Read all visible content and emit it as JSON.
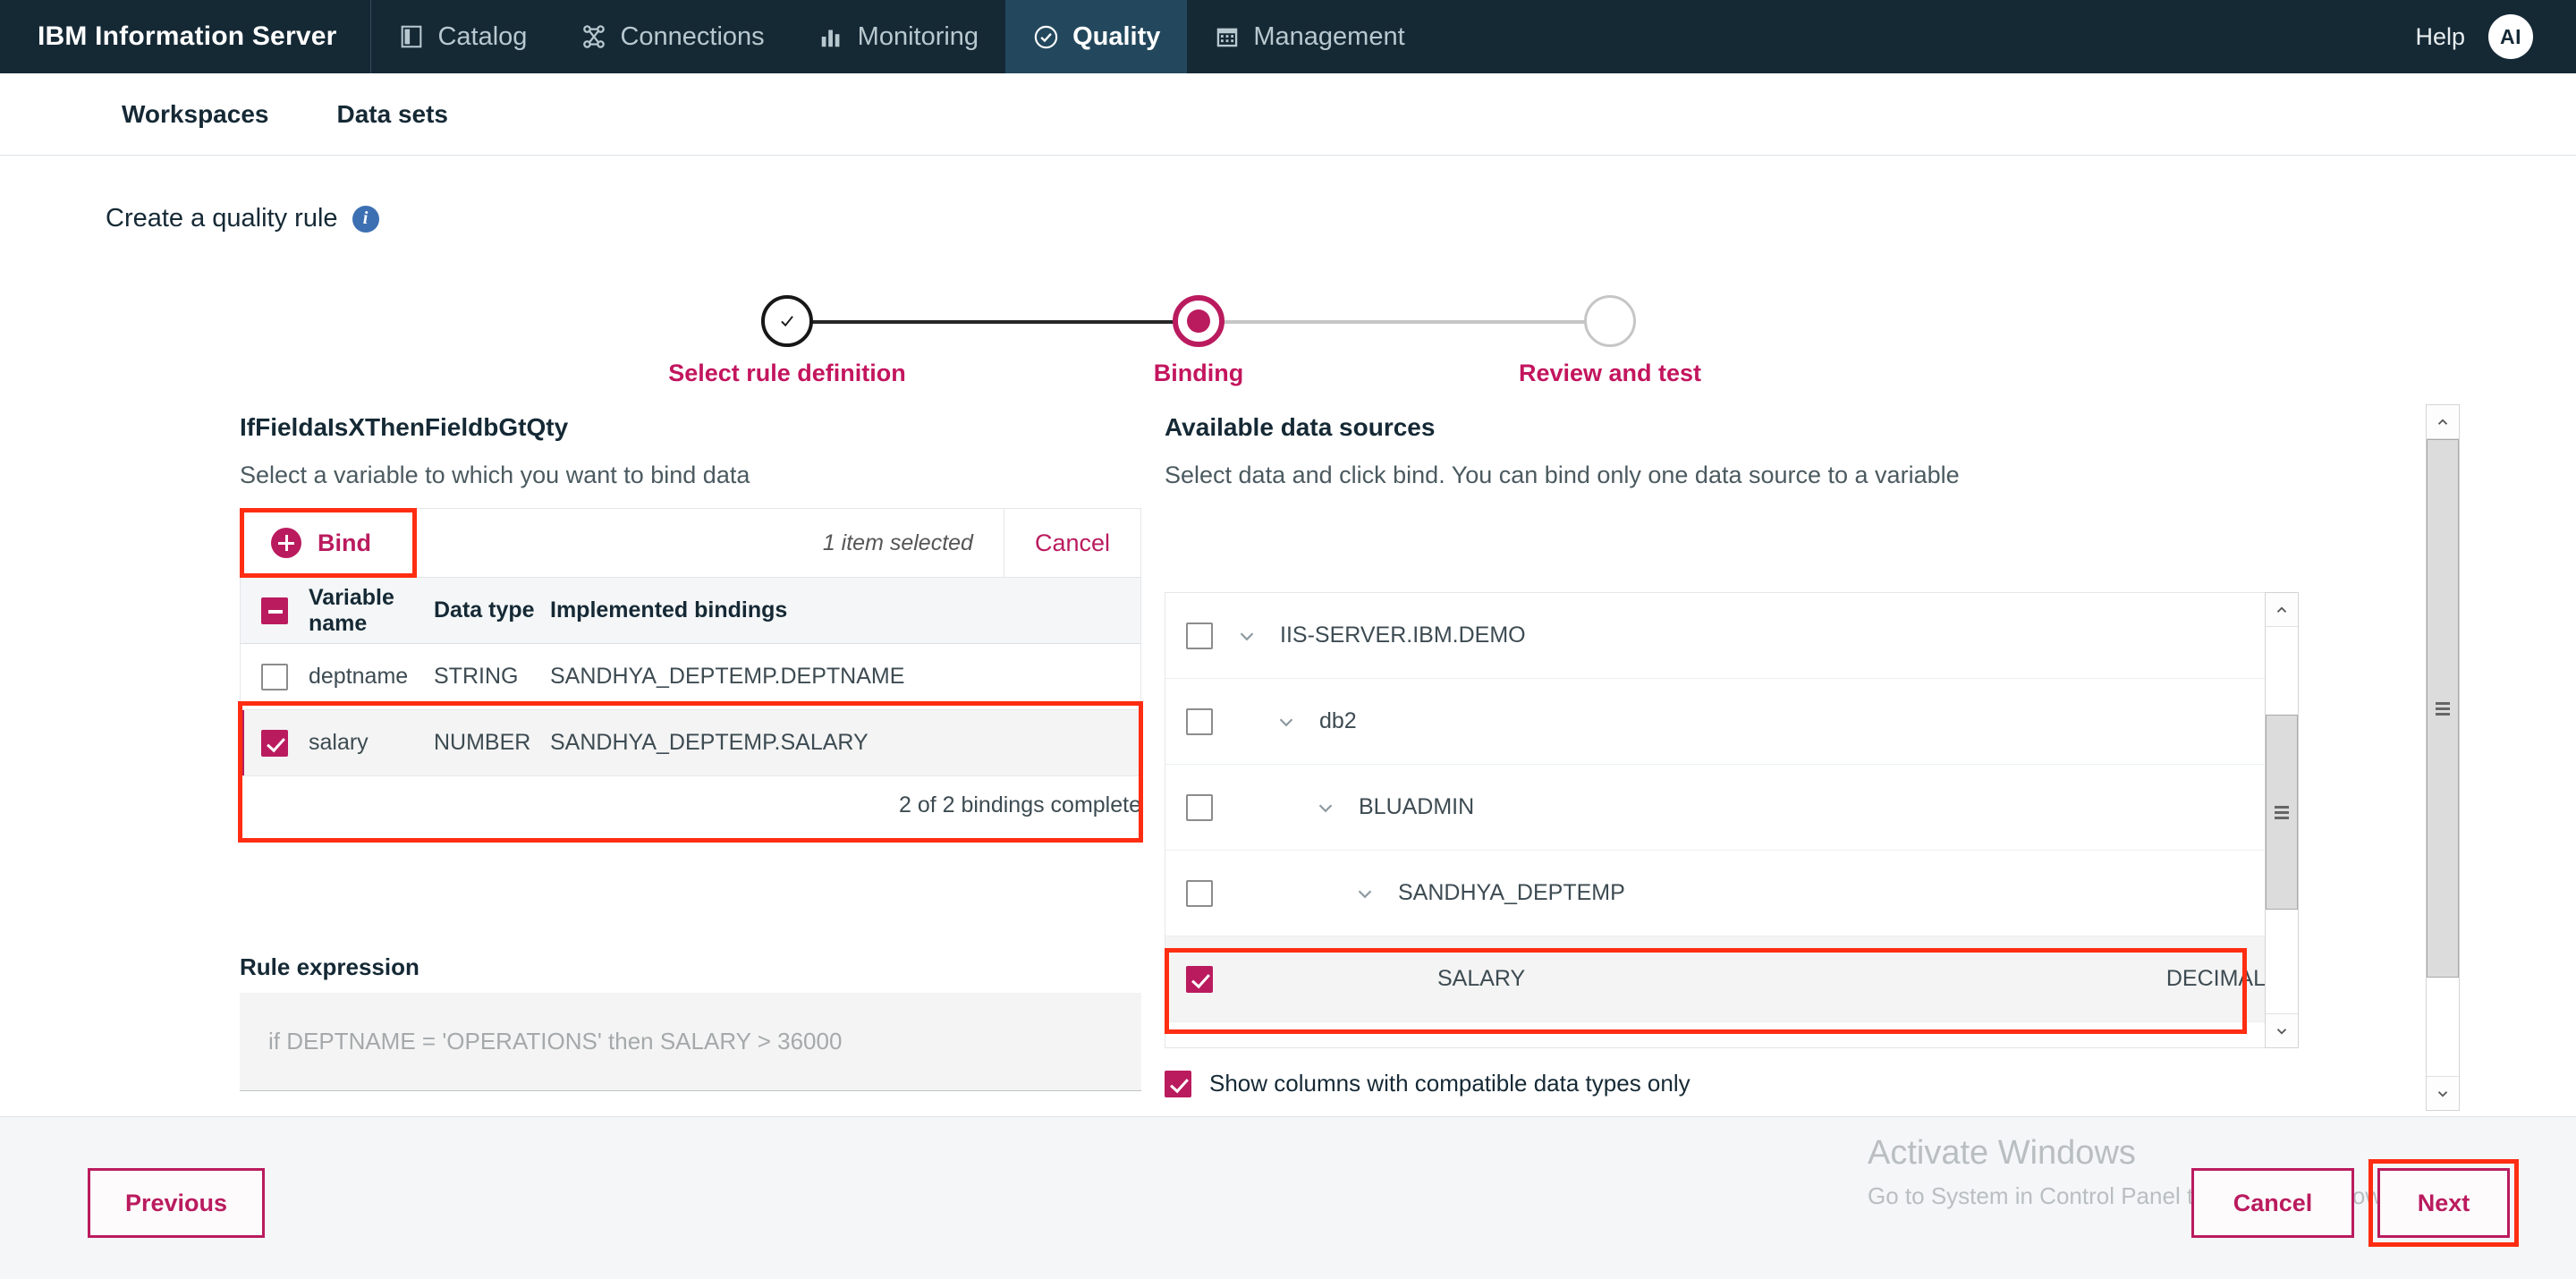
{
  "header": {
    "brand": "IBM Information Server",
    "nav": [
      {
        "label": "Catalog",
        "icon": "catalog-icon",
        "active": false
      },
      {
        "label": "Connections",
        "icon": "connections-icon",
        "active": false
      },
      {
        "label": "Monitoring",
        "icon": "monitoring-icon",
        "active": false
      },
      {
        "label": "Quality",
        "icon": "quality-check-icon",
        "active": true
      },
      {
        "label": "Management",
        "icon": "management-calendar-icon",
        "active": false
      }
    ],
    "help": "Help",
    "avatar": "AI"
  },
  "subnav": {
    "items": [
      {
        "label": "Workspaces"
      },
      {
        "label": "Data sets"
      }
    ]
  },
  "page": {
    "title": "Create a quality rule",
    "info_icon": "info-icon"
  },
  "stepper": {
    "steps": [
      {
        "label": "Select rule definition",
        "state": "done"
      },
      {
        "label": "Binding",
        "state": "current"
      },
      {
        "label": "Review and test",
        "state": "todo"
      }
    ]
  },
  "left": {
    "heading": "IfFieldaIsXThenFieldbGtQty",
    "subtitle": "Select a variable to which you want to bind data",
    "toolbar": {
      "bind_label": "Bind",
      "selected_count": "1 item selected",
      "cancel_label": "Cancel"
    },
    "table": {
      "columns": [
        "Variable name",
        "Data type",
        "Implemented bindings"
      ],
      "header_checkbox": "indeterminate",
      "rows": [
        {
          "checked": false,
          "variable": "deptname",
          "type": "STRING",
          "binding": "SANDHYA_DEPTEMP.DEPTNAME"
        },
        {
          "checked": true,
          "variable": "salary",
          "type": "NUMBER",
          "binding": "SANDHYA_DEPTEMP.SALARY"
        }
      ]
    },
    "bindings_note": "2 of 2 bindings complete",
    "rule_expression_label": "Rule expression",
    "rule_expression": "if DEPTNAME = 'OPERATIONS' then SALARY > 36000"
  },
  "right": {
    "heading": "Available data sources",
    "subtitle": "Select data and click bind. You can bind only one data source to a variable",
    "tree": [
      {
        "label": "IIS-SERVER.IBM.DEMO",
        "depth": 0,
        "checked": false,
        "expandable": true,
        "type": "",
        "selected": false
      },
      {
        "label": "db2",
        "depth": 1,
        "checked": false,
        "expandable": true,
        "type": "",
        "selected": false
      },
      {
        "label": "BLUADMIN",
        "depth": 2,
        "checked": false,
        "expandable": true,
        "type": "",
        "selected": false
      },
      {
        "label": "SANDHYA_DEPTEMP",
        "depth": 3,
        "checked": false,
        "expandable": true,
        "type": "",
        "selected": false
      },
      {
        "label": "SALARY",
        "depth": 4,
        "checked": true,
        "expandable": false,
        "type": "DECIMAL",
        "selected": true
      }
    ],
    "compatible_label": "Show columns with compatible data types only",
    "compatible_checked": true
  },
  "footer": {
    "previous": "Previous",
    "cancel": "Cancel",
    "next": "Next"
  },
  "watermark": {
    "title": "Activate Windows",
    "subtitle": "Go to System in Control Panel to activate Windows."
  },
  "colors": {
    "navbar": "#152935",
    "navbar_active": "#23485d",
    "accent_magenta": "#ba1b5e",
    "step_label": "#c3155e",
    "annotation_red": "#ff2d12",
    "info_blue": "#3d70b2"
  }
}
